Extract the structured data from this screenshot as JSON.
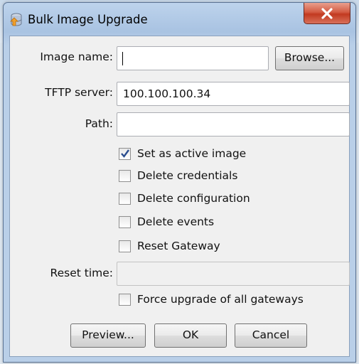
{
  "window": {
    "title": "Bulk Image Upgrade",
    "icon": "database-upgrade-icon"
  },
  "form": {
    "image_name": {
      "label": "Image name:",
      "value": ""
    },
    "browse_label": "Browse...",
    "tftp_server": {
      "label": "TFTP server:",
      "value": "100.100.100.34"
    },
    "path": {
      "label": "Path:",
      "value": ""
    },
    "options": [
      {
        "label": "Set as active image",
        "checked": true
      },
      {
        "label": "Delete credentials",
        "checked": false
      },
      {
        "label": "Delete configuration",
        "checked": false
      },
      {
        "label": "Delete events",
        "checked": false
      },
      {
        "label": "Reset Gateway",
        "checked": false
      }
    ],
    "reset_time": {
      "label": "Reset time:",
      "value": "",
      "enabled": false
    },
    "force_upgrade": {
      "label": "Force upgrade of all gateways",
      "checked": false
    }
  },
  "buttons": {
    "preview": "Preview...",
    "ok": "OK",
    "cancel": "Cancel"
  },
  "colors": {
    "close_button": "#c8432a",
    "checkmark": "#2a4d8f"
  }
}
